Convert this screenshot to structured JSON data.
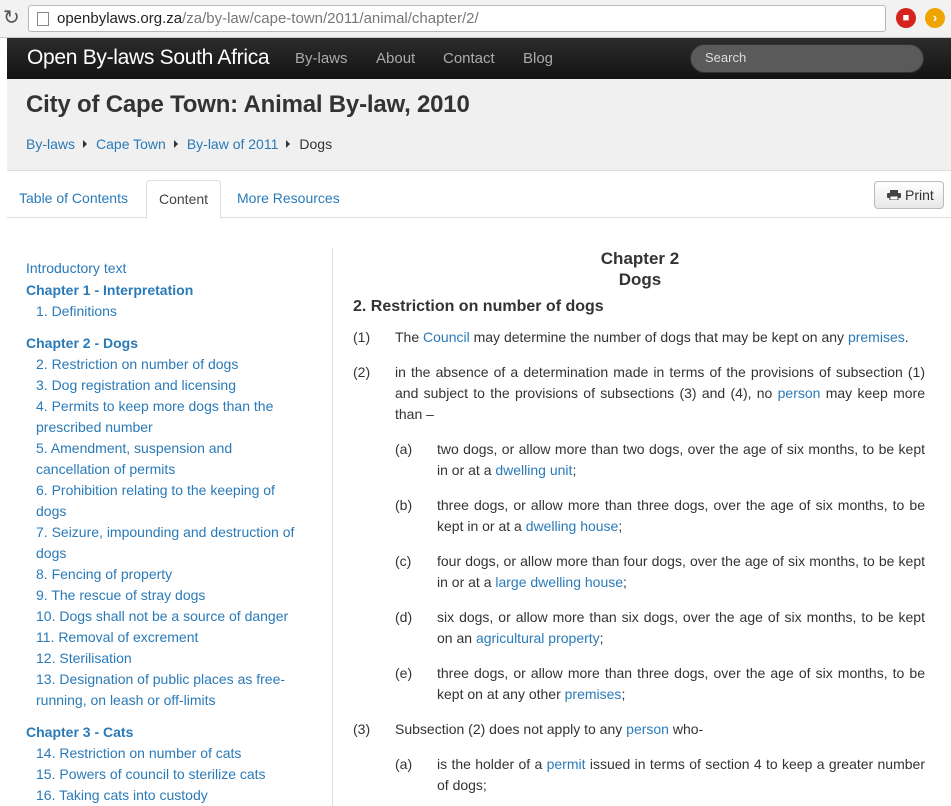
{
  "browser": {
    "url_domain": "openbylaws.org.za",
    "url_path": "/za/by-law/cape-town/2011/animal/chapter/2/",
    "ext1_icon": "stop-sign-icon",
    "ext2_icon": "forward-arrow-icon"
  },
  "navbar": {
    "brand": "Open By-laws South Africa",
    "links": [
      "By-laws",
      "About",
      "Contact",
      "Blog"
    ],
    "search_placeholder": "Search"
  },
  "header": {
    "title": "City of Cape Town: Animal By-law, 2010",
    "breadcrumbs": [
      "By-laws",
      "Cape Town",
      "By-law of 2011",
      "Dogs"
    ]
  },
  "tabs": [
    "Table of Contents",
    "Content",
    "More Resources"
  ],
  "print_label": "Print",
  "toc": [
    {
      "text": "Introductory text",
      "kind": "plain"
    },
    {
      "text": "Chapter 1 - Interpretation",
      "kind": "chap"
    },
    {
      "text": "1. Definitions",
      "kind": "sub"
    },
    {
      "text": "Chapter 2 - Dogs",
      "kind": "chap"
    },
    {
      "text": "2. Restriction on number of dogs",
      "kind": "sub"
    },
    {
      "text": "3. Dog registration and licensing",
      "kind": "sub"
    },
    {
      "text": "4. Permits to keep more dogs than the",
      "kind": "sub"
    },
    {
      "text": "prescribed number",
      "kind": "sub"
    },
    {
      "text": "5. Amendment, suspension and",
      "kind": "sub"
    },
    {
      "text": "cancellation of permits",
      "kind": "sub"
    },
    {
      "text": "6. Prohibition relating to the keeping of",
      "kind": "sub"
    },
    {
      "text": "dogs",
      "kind": "sub"
    },
    {
      "text": "7. Seizure, impounding and destruction of",
      "kind": "sub"
    },
    {
      "text": "dogs",
      "kind": "sub"
    },
    {
      "text": "8. Fencing of property",
      "kind": "sub"
    },
    {
      "text": "9. The rescue of stray dogs",
      "kind": "sub"
    },
    {
      "text": "10. Dogs shall not be a source of danger",
      "kind": "sub"
    },
    {
      "text": "11. Removal of excrement",
      "kind": "sub"
    },
    {
      "text": "12. Sterilisation",
      "kind": "sub"
    },
    {
      "text": "13. Designation of public places as free-",
      "kind": "sub"
    },
    {
      "text": "running, on leash or off-limits",
      "kind": "sub"
    },
    {
      "text": "Chapter 3 - Cats",
      "kind": "chap"
    },
    {
      "text": "14. Restriction on number of cats",
      "kind": "sub"
    },
    {
      "text": "15. Powers of council to sterilize cats",
      "kind": "sub"
    },
    {
      "text": "16. Taking cats into custody",
      "kind": "sub"
    }
  ],
  "content": {
    "chapter_line1": "Chapter 2",
    "chapter_line2": "Dogs",
    "section_title": "2. Restriction on number of dogs",
    "s1_num": "(1)",
    "s1_a": "The ",
    "s1_link1": "Council",
    "s1_b": " may determine the number of dogs that may be kept on any ",
    "s1_link2": "premises",
    "s1_c": ".",
    "s2_num": "(2)",
    "s2_a": "in the absence of a determination made in terms of the provisions of subsection (1) and subject to the provisions of subsections (3) and (4), no ",
    "s2_link": "person",
    "s2_b": " may keep more than –",
    "a_num": "(a)",
    "a_text": "two dogs, or allow more than two dogs, over the age of six months, to be kept in or at a ",
    "a_link": "dwelling unit",
    "a_end": ";",
    "b_num": "(b)",
    "b_text": "three dogs, or allow more than three dogs, over the age of six months, to be kept in or at a ",
    "b_link": "dwelling house",
    "b_end": ";",
    "c_num": "(c)",
    "c_text": "four dogs, or allow more than four dogs, over the age of six months, to be kept in or at a ",
    "c_link": "large dwelling house",
    "c_end": ";",
    "d_num": "(d)",
    "d_text": "six dogs, or allow more than six dogs, over the age of six months, to be kept on an ",
    "d_link": "agricultural property",
    "d_end": ";",
    "e_num": "(e)",
    "e_text": "three dogs, or allow more than three dogs, over the age of six months, to be kept on at any other ",
    "e_link": "premises",
    "e_end": ";",
    "s3_num": "(3)",
    "s3_a": "Subsection (2) does not apply to any ",
    "s3_link": "person",
    "s3_b": " who-",
    "s3a_num": "(a)",
    "s3a_a": "is the holder of a ",
    "s3a_link": "permit",
    "s3a_b": " issued in terms of section 4 to keep a greater number of dogs;"
  }
}
